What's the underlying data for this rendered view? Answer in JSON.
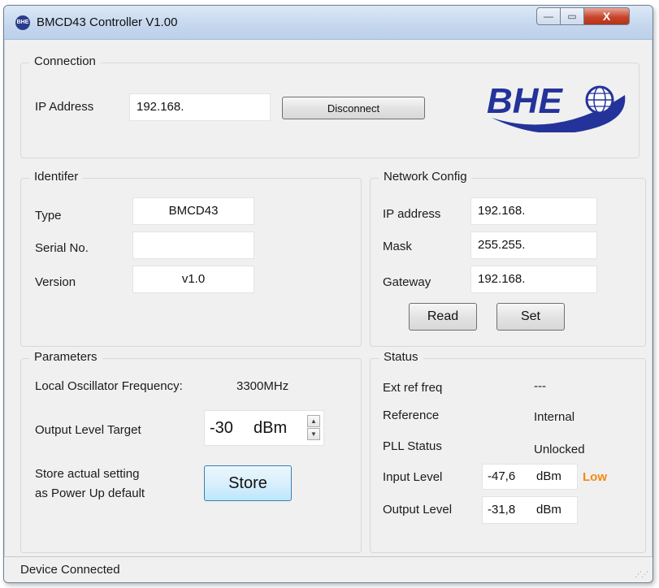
{
  "window": {
    "title": "BMCD43 Controller V1.00",
    "app_icon": "BHE",
    "minimize_glyph": "—",
    "maximize_glyph": "▭",
    "close_glyph": "X"
  },
  "connection": {
    "title": "Connection",
    "ip_label": "IP Address",
    "ip_value": "192.168.",
    "disconnect_label": "Disconnect",
    "logo_text": "BHE"
  },
  "identifier": {
    "title": "Identifer",
    "type_label": "Type",
    "type_value": "BMCD43",
    "serial_label": "Serial No.",
    "serial_value": "",
    "version_label": "Version",
    "version_value": "v1.0"
  },
  "network": {
    "title": "Network Config",
    "ip_label": "IP address",
    "ip_value": "192.168.",
    "mask_label": "Mask",
    "mask_value": "255.255.",
    "gateway_label": "Gateway",
    "gateway_value": "192.168.",
    "read_label": "Read",
    "set_label": "Set"
  },
  "parameters": {
    "title": "Parameters",
    "lo_freq_label": "Local Oscillator Frequency:",
    "lo_freq_value": "3300MHz",
    "output_target_label": "Output Level Target",
    "output_target_value": "-30",
    "output_target_unit": "dBm",
    "store_line1": "Store actual setting",
    "store_line2": "as Power Up default",
    "store_label": "Store"
  },
  "status": {
    "title": "Status",
    "ext_ref_label": "Ext ref freq",
    "ext_ref_value": "---",
    "reference_label": "Reference",
    "reference_value": "Internal",
    "pll_label": "PLL Status",
    "pll_value": "Unlocked",
    "input_level_label": "Input Level",
    "input_level_value": "-47,6",
    "input_level_unit": "dBm",
    "input_level_badge": "Low",
    "output_level_label": "Output Level",
    "output_level_value": "-31,8",
    "output_level_unit": "dBm"
  },
  "statusbar": {
    "text": "Device Connected"
  },
  "colors": {
    "logo_blue": "#24339a",
    "low_badge": "#f28a14",
    "window_bg": "#f0f0f0"
  }
}
